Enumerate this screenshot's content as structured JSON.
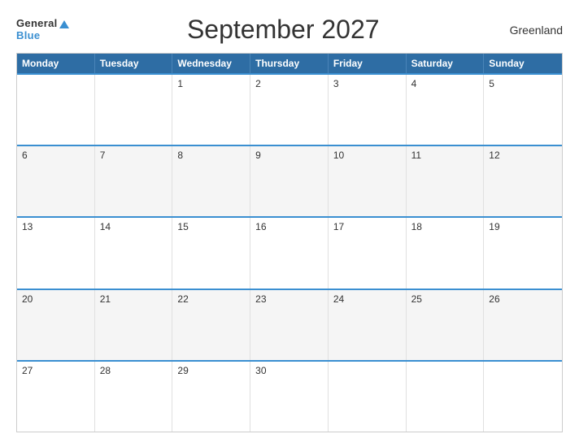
{
  "header": {
    "logo_general": "General",
    "logo_blue": "Blue",
    "title": "September 2027",
    "region": "Greenland"
  },
  "calendar": {
    "days_of_week": [
      "Monday",
      "Tuesday",
      "Wednesday",
      "Thursday",
      "Friday",
      "Saturday",
      "Sunday"
    ],
    "weeks": [
      [
        {
          "day": "",
          "empty": true
        },
        {
          "day": "",
          "empty": true
        },
        {
          "day": "1",
          "empty": false
        },
        {
          "day": "2",
          "empty": false
        },
        {
          "day": "3",
          "empty": false
        },
        {
          "day": "4",
          "empty": false
        },
        {
          "day": "5",
          "empty": false
        }
      ],
      [
        {
          "day": "6",
          "empty": false
        },
        {
          "day": "7",
          "empty": false
        },
        {
          "day": "8",
          "empty": false
        },
        {
          "day": "9",
          "empty": false
        },
        {
          "day": "10",
          "empty": false
        },
        {
          "day": "11",
          "empty": false
        },
        {
          "day": "12",
          "empty": false
        }
      ],
      [
        {
          "day": "13",
          "empty": false
        },
        {
          "day": "14",
          "empty": false
        },
        {
          "day": "15",
          "empty": false
        },
        {
          "day": "16",
          "empty": false
        },
        {
          "day": "17",
          "empty": false
        },
        {
          "day": "18",
          "empty": false
        },
        {
          "day": "19",
          "empty": false
        }
      ],
      [
        {
          "day": "20",
          "empty": false
        },
        {
          "day": "21",
          "empty": false
        },
        {
          "day": "22",
          "empty": false
        },
        {
          "day": "23",
          "empty": false
        },
        {
          "day": "24",
          "empty": false
        },
        {
          "day": "25",
          "empty": false
        },
        {
          "day": "26",
          "empty": false
        }
      ],
      [
        {
          "day": "27",
          "empty": false
        },
        {
          "day": "28",
          "empty": false
        },
        {
          "day": "29",
          "empty": false
        },
        {
          "day": "30",
          "empty": false
        },
        {
          "day": "",
          "empty": true
        },
        {
          "day": "",
          "empty": true
        },
        {
          "day": "",
          "empty": true
        }
      ]
    ]
  }
}
